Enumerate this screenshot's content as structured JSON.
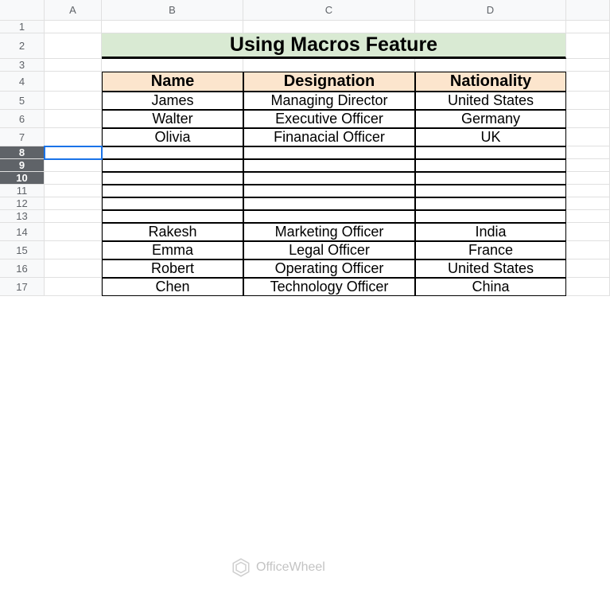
{
  "columns": [
    "A",
    "B",
    "C",
    "D",
    ""
  ],
  "rows": [
    "1",
    "2",
    "3",
    "4",
    "5",
    "6",
    "7",
    "8",
    "9",
    "10",
    "11",
    "12",
    "13",
    "14",
    "15",
    "16",
    "17"
  ],
  "selected_rows": [
    "8",
    "9",
    "10"
  ],
  "title": "Using Macros Feature",
  "headers": {
    "b": "Name",
    "c": "Designation",
    "d": "Nationality"
  },
  "data": {
    "r5": {
      "b": "James",
      "c": "Managing Director",
      "d": "United States"
    },
    "r6": {
      "b": "Walter",
      "c": "Executive Officer",
      "d": "Germany"
    },
    "r7": {
      "b": "Olivia",
      "c": "Finanacial  Officer",
      "d": "UK"
    },
    "r14": {
      "b": "Rakesh",
      "c": "Marketing  Officer",
      "d": "India"
    },
    "r15": {
      "b": "Emma",
      "c": "Legal  Officer",
      "d": "France"
    },
    "r16": {
      "b": "Robert",
      "c": "Operating Officer",
      "d": "United States"
    },
    "r17": {
      "b": "Chen",
      "c": "Technology Officer",
      "d": "China"
    }
  },
  "watermark": "OfficeWheel"
}
